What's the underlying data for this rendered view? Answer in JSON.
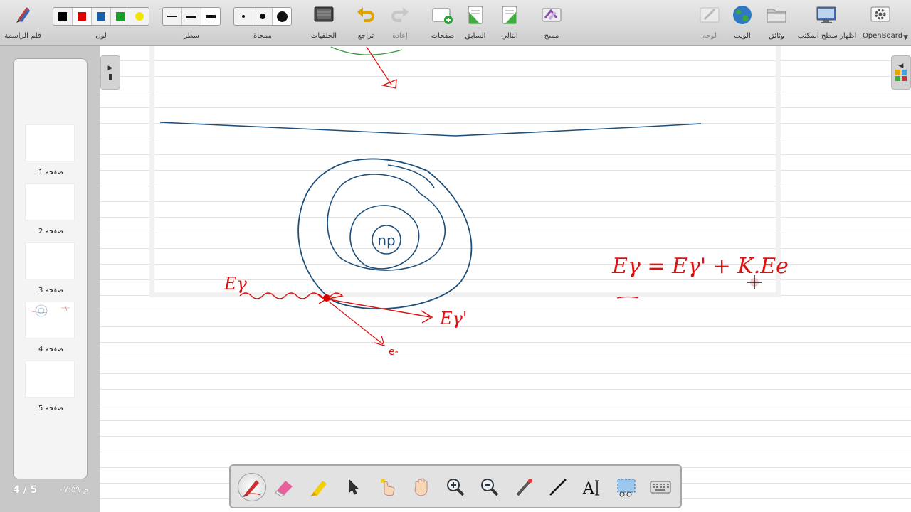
{
  "toolbar": {
    "pen_label": "قلم الراسمة",
    "color_label": "لون",
    "line_label": "سطر",
    "eraser_label": "ممحاة",
    "backgrounds_label": "الخلفيات",
    "undo_label": "تراجع",
    "redo_label": "إعادة",
    "pages_label": "صفحات",
    "previous_label": "السابق",
    "next_label": "التالي",
    "erase_label": "مسح",
    "board_label": "لوحه",
    "web_label": "الويب",
    "documents_label": "وثائق",
    "desktop_label": "اظهار سطح المكتب",
    "openboard_label": "OpenBoard",
    "colors": [
      "#000000",
      "#e00000",
      "#1a5fa8",
      "#1a9e2a",
      "#f2e600"
    ],
    "selected_color": "#e00000"
  },
  "sidebar": {
    "pages": [
      {
        "label": "صفحة 1"
      },
      {
        "label": "صفحة 2"
      },
      {
        "label": "صفحة 3"
      },
      {
        "label": "صفحة 4"
      },
      {
        "label": "صفحة 5"
      }
    ]
  },
  "status": {
    "page_counter": "4 / 5",
    "clock": "۰۷:۵۹ م"
  },
  "board": {
    "nucleus_label": "np",
    "photon_in_label": "Eγ",
    "photon_out_label": "Eγ'",
    "electron_label": "e-",
    "equation": "Eγ = Eγ' + K.Ee"
  },
  "palette": {
    "tools": [
      "pen-tool",
      "eraser-tool",
      "highlighter-tool",
      "selector-tool",
      "interact-tool",
      "hand-tool",
      "zoom-in-tool",
      "zoom-out-tool",
      "laser-pointer-tool",
      "line-tool",
      "text-tool",
      "capture-tool",
      "keyboard-tool"
    ],
    "active_tool": "pen-tool"
  }
}
